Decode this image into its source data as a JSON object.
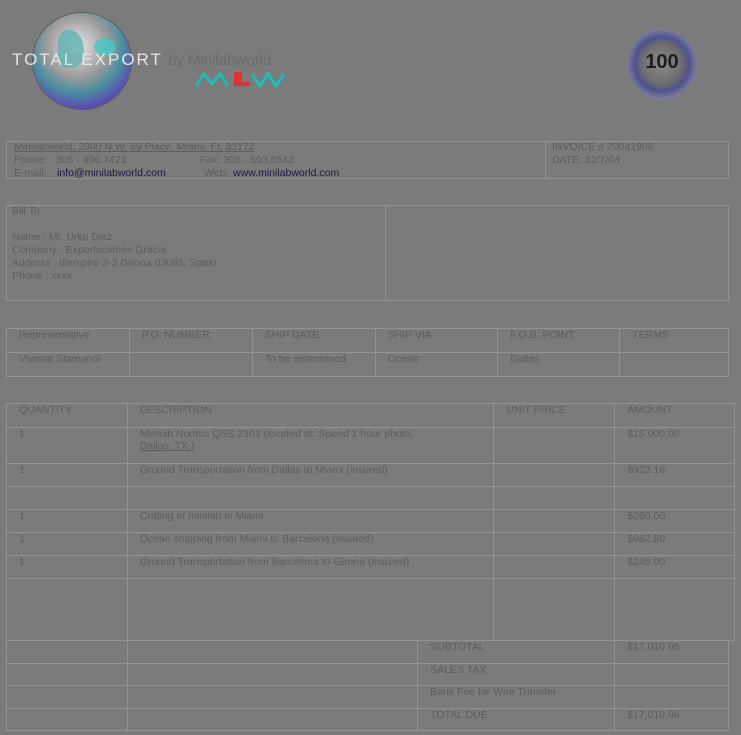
{
  "logo": {
    "brand": "TOTAL EXPORT",
    "by": "by Minilabworld",
    "mark": "MLW"
  },
  "seal": {
    "text": "100"
  },
  "company": {
    "name_line": "Minilabworld, 2000 N.W. 89 Place, Miami, FL 33172",
    "phone_label": "Phone:",
    "phone": "305 - 496.7421",
    "fax_label": "Fax: 305 - 593.6542",
    "email_label": "E-mail:",
    "email": "info@minilabworld.com",
    "web_label": "Web:",
    "web": "www.minilabworld.com"
  },
  "invoice": {
    "number": "INVOICE # 20041908",
    "date": "DATE: 12/7/04"
  },
  "bill_to": {
    "heading": "Bill To",
    "name": "Name : Mr. Urko Diaz",
    "company": "Company : Exportaciones Gracia",
    "address": "Address : d'empire 3-3 Girona 03085, Spain",
    "phone": "Phone : xxxx"
  },
  "shipping": {
    "headers": [
      "Representative",
      "P.O. NUMBER",
      "SHIP DATE",
      "SHIP VIA",
      "F.O.B. POINT",
      "TERMS"
    ],
    "values": [
      "Viviana Stamanoi",
      "",
      "To be determined",
      "Ocean",
      "Dallas",
      ""
    ]
  },
  "items": {
    "headers": [
      "QUANTITY",
      "DESCRIPTION",
      "UNIT PRICE",
      "AMOUNT"
    ],
    "rows": [
      {
        "qty": "1",
        "desc": "Minilab Noritsu QSS 2301 (located at: Speed 1 hour photo,",
        "price": "",
        "amount": "$15,000.00"
      },
      {
        "qty": "1",
        "desc": "Ground Transportation from Dallas to Miami (insured)",
        "price": "",
        "amount": "$923.16"
      },
      {
        "qty": "",
        "desc": "",
        "price": "",
        "amount": ""
      },
      {
        "qty": "1",
        "desc": "Crating of minilab in Miami",
        "price": "",
        "amount": "$260.00"
      },
      {
        "qty": "1",
        "desc": "Ocean shipping from Miami to Barcelona (insured)",
        "price": "",
        "amount": "$982.80"
      },
      {
        "qty": "1",
        "desc": "Ground Transportation from Barcelona to Girona (insured)",
        "price": "",
        "amount": "$245.00"
      }
    ],
    "desc_sub": "Dallas, TX.)"
  },
  "totals": {
    "subtotal_label": "SUBTOTAL",
    "subtotal": "$17,010.96",
    "tax_label": "SALES TAX",
    "tax": "",
    "bank_label": "Bank Fee for Wire Transfer",
    "bank": "",
    "total_label": "TOTAL DUE",
    "total": "$17,010.96"
  }
}
